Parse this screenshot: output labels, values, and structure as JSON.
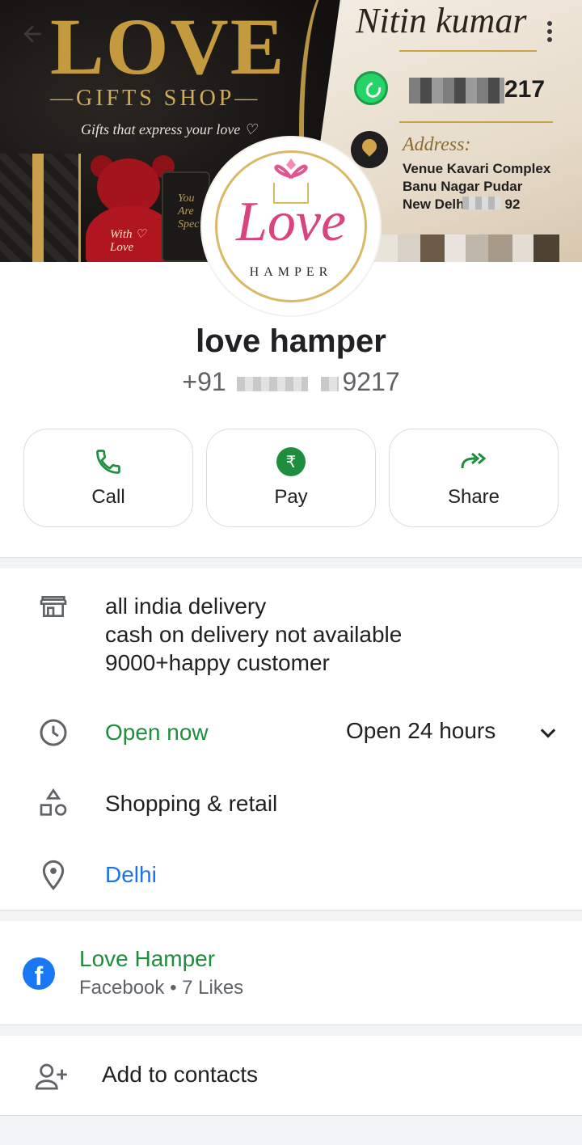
{
  "cover": {
    "love_title": "LOVE",
    "gifts_shop": "—GIFTS SHOP—",
    "tagline": "Gifts that express your love ♡",
    "bear_label": "With ♡\nLove",
    "mug_text": "You\nAre\nSpec",
    "owner_script": "Nitin kumar",
    "whatsapp_suffix": "217",
    "address_heading": "Address:",
    "address_line1": "Venue Kavari Complex",
    "address_line2": "Banu Nagar Pudar",
    "address_line3": "New Delh",
    "address_suffix": "92"
  },
  "logo": {
    "script": "Love",
    "subtext": "HAMPER"
  },
  "profile": {
    "name": "love hamper",
    "phone_prefix": "+91",
    "phone_suffix": "9217"
  },
  "actions": [
    {
      "label": "Call",
      "icon": "phone-icon"
    },
    {
      "label": "Pay",
      "icon": "rupee-icon"
    },
    {
      "label": "Share",
      "icon": "share-arrow-icon"
    }
  ],
  "details": {
    "description_lines": [
      "all india delivery",
      "cash on delivery not available",
      "9000+happy customer"
    ],
    "open_status": "Open now",
    "hours": "Open 24 hours",
    "category": "Shopping & retail",
    "location": "Delhi"
  },
  "facebook": {
    "title": "Love Hamper",
    "subtitle": "Facebook • 7 Likes"
  },
  "contacts": {
    "add_label": "Add to contacts"
  },
  "colors": {
    "accent_green": "#1e8e3e",
    "link_blue": "#1a73e8",
    "facebook_blue": "#1877f2"
  }
}
